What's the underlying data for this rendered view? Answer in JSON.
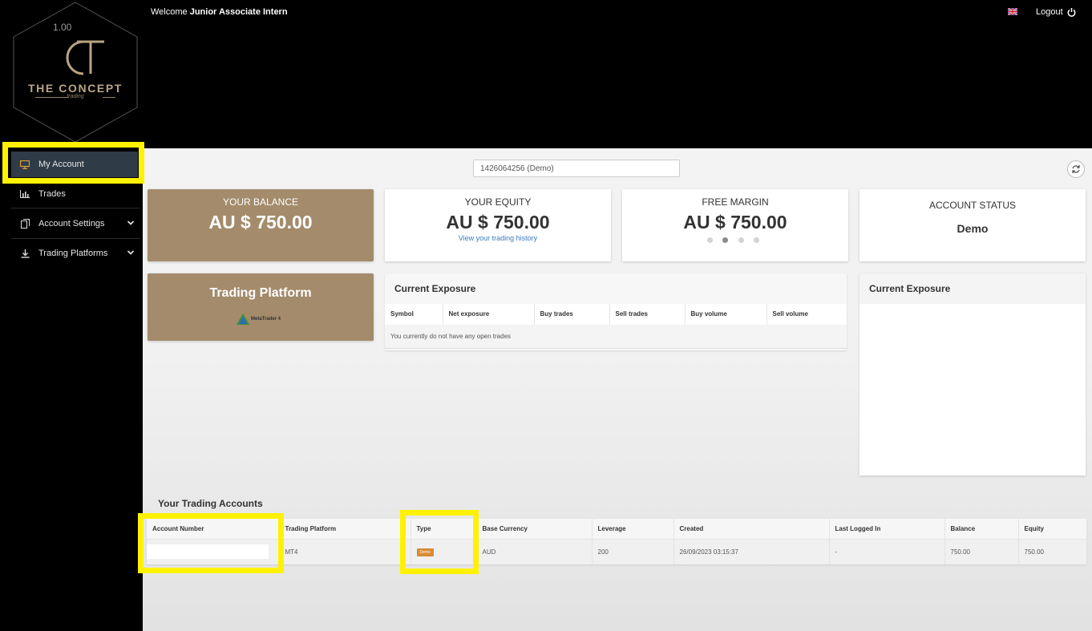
{
  "app": {
    "version": "1.00",
    "brand_name": "THE CONCEPT",
    "brand_sub": "trading"
  },
  "header": {
    "welcome_prefix": "Welcome",
    "user_name": "Junior Associate Intern",
    "logout_label": "Logout"
  },
  "sidebar": {
    "items": [
      {
        "label": "My Account",
        "icon": "monitor-icon",
        "active": true
      },
      {
        "label": "Trades",
        "icon": "bar-chart-icon"
      },
      {
        "label": "Account Settings",
        "icon": "copy-icon",
        "expandable": true
      },
      {
        "label": "Trading Platforms",
        "icon": "download-icon",
        "expandable": true
      }
    ]
  },
  "account_selector": {
    "value": "1426064256 (Demo)"
  },
  "cards": {
    "balance": {
      "title": "YOUR BALANCE",
      "value": "AU $ 750.00"
    },
    "equity": {
      "title": "YOUR EQUITY",
      "value": "AU $ 750.00",
      "link": "View your trading history"
    },
    "margin": {
      "title": "FREE MARGIN",
      "value": "AU $ 750.00"
    },
    "status": {
      "title": "ACCOUNT STATUS",
      "value": "Demo"
    },
    "platform": {
      "title": "Trading Platform",
      "logo_text": "MetaTrader 4"
    }
  },
  "exposure": {
    "title": "Current Exposure",
    "columns": [
      "Symbol",
      "Net exposure",
      "Buy trades",
      "Sell trades",
      "Buy volume",
      "Sell volume"
    ],
    "empty_message": "You currently do not have any open trades"
  },
  "exposure_chart": {
    "title": "Current Exposure"
  },
  "trading_accounts": {
    "title": "Your Trading Accounts",
    "columns": [
      "Account Number",
      "Trading Platform",
      "Type",
      "Base Currency",
      "Leverage",
      "Created",
      "Last Logged In",
      "Balance",
      "Equity"
    ],
    "rows": [
      {
        "account_number": "",
        "platform": "MT4",
        "type": "Demo",
        "currency": "AUD",
        "leverage": "200",
        "created": "26/09/2023 03:15:37",
        "last_logged_in": "-",
        "balance": "750.00",
        "equity": "750.00"
      }
    ]
  },
  "colors": {
    "gold": "#a38b6b",
    "highlight": "#fff200",
    "active_nav": "#303b48",
    "badge": "#d98a33",
    "link": "#3a7bbf"
  }
}
